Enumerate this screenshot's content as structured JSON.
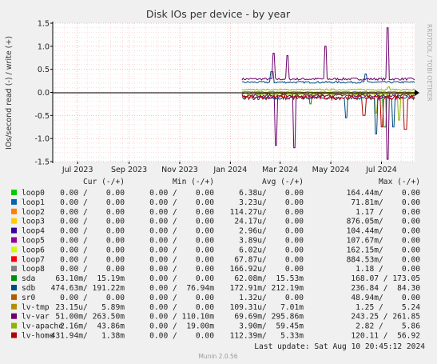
{
  "chart_data": {
    "type": "line",
    "title": "Disk IOs per device - by year",
    "ylabel": "IOs/second read (-) / write (+)",
    "ylim": [
      -1.5,
      1.5
    ],
    "yticks": [
      "1.5",
      "1.0",
      "0.5",
      "0.0",
      "-0.5",
      "-1.0",
      "-1.5"
    ],
    "ytick_values": [
      1.5,
      1.0,
      0.5,
      0.0,
      -0.5,
      -1.0,
      -1.5
    ],
    "xlim": [
      "2023-06-01",
      "2024-08-10"
    ],
    "xticks": [
      {
        "label": "Jul 2023",
        "date": "2023-07-01"
      },
      {
        "label": "Sep 2023",
        "date": "2023-09-01"
      },
      {
        "label": "Nov 2023",
        "date": "2023-11-01"
      },
      {
        "label": "Jan 2024",
        "date": "2024-01-01"
      },
      {
        "label": "Mar 2024",
        "date": "2024-03-01"
      },
      {
        "label": "May 2024",
        "date": "2024-05-01"
      },
      {
        "label": "Jul 2024",
        "date": "2024-07-01"
      }
    ],
    "grid": true,
    "side_text": "RRDTOOL / TOBI OETIKER",
    "legend_header": {
      "cur": "Cur (-/+)",
      "min": "Min (-/+)",
      "avg": "Avg (-/+)",
      "max": "Max (-/+)"
    },
    "series": [
      {
        "name": "loop0",
        "color": "#00cc00",
        "cur": "0.00 /    0.00",
        "min": "0.00 /    0.00",
        "avg": "6.38u/    0.00",
        "max": "164.44m/    0.00"
      },
      {
        "name": "loop1",
        "color": "#0066b3",
        "cur": "0.00 /    0.00",
        "min": "0.00 /    0.00",
        "avg": "3.23u/    0.00",
        "max": "71.81m/    0.00"
      },
      {
        "name": "loop2",
        "color": "#ff8000",
        "cur": "0.00 /    0.00",
        "min": "0.00 /    0.00",
        "avg": "114.27u/    0.00",
        "max": "1.17 /    0.00"
      },
      {
        "name": "loop3",
        "color": "#ffcc00",
        "cur": "0.00 /    0.00",
        "min": "0.00 /    0.00",
        "avg": "24.17u/    0.00",
        "max": "876.05m/    0.00"
      },
      {
        "name": "loop4",
        "color": "#330099",
        "cur": "0.00 /    0.00",
        "min": "0.00 /    0.00",
        "avg": "2.96u/    0.00",
        "max": "104.44m/    0.00"
      },
      {
        "name": "loop5",
        "color": "#990099",
        "cur": "0.00 /    0.00",
        "min": "0.00 /    0.00",
        "avg": "3.89u/    0.00",
        "max": "107.67m/    0.00"
      },
      {
        "name": "loop6",
        "color": "#ccff00",
        "cur": "0.00 /    0.00",
        "min": "0.00 /    0.00",
        "avg": "6.02u/    0.00",
        "max": "162.15m/    0.00"
      },
      {
        "name": "loop7",
        "color": "#ff0000",
        "cur": "0.00 /    0.00",
        "min": "0.00 /    0.00",
        "avg": "67.87u/    0.00",
        "max": "884.53m/    0.00"
      },
      {
        "name": "loop8",
        "color": "#808080",
        "cur": "0.00 /    0.00",
        "min": "0.00 /    0.00",
        "avg": "166.92u/    0.00",
        "max": "1.18 /    0.00"
      },
      {
        "name": "sda",
        "color": "#008f00",
        "cur": "63.10m/  15.19m",
        "min": "0.00 /    0.00",
        "avg": "62.08m/  15.53m",
        "max": "168.07 / 173.05"
      },
      {
        "name": "sdb",
        "color": "#00487d",
        "cur": "474.63m/ 191.22m",
        "min": "0.00 /  76.94m",
        "avg": "172.91m/ 212.19m",
        "max": "236.84 /  84.30"
      },
      {
        "name": "sr0",
        "color": "#b35a00",
        "cur": "0.00 /    0.00",
        "min": "0.00 /    0.00",
        "avg": "1.32u/    0.00",
        "max": "48.94m/    0.00"
      },
      {
        "name": "lv-tmp",
        "color": "#b38f00",
        "cur": "23.15u/   5.89m",
        "min": "0.00 /    0.00",
        "avg": "109.31u/   7.01m",
        "max": "1.25 /    5.24"
      },
      {
        "name": "lv-var",
        "color": "#6b006b",
        "cur": "51.00m/ 263.50m",
        "min": "0.00 / 110.10m",
        "avg": "69.69m/ 295.86m",
        "max": "243.25 / 261.85"
      },
      {
        "name": "lv-apache",
        "color": "#8fb300",
        "cur": "2.16m/  43.86m",
        "min": "0.00 /  19.00m",
        "avg": "3.90m/  59.45m",
        "max": "2.82 /    5.86"
      },
      {
        "name": "lv-home",
        "color": "#b30000",
        "cur": "431.94m/   1.38m",
        "min": "0.00 /    0.00",
        "avg": "112.39m/   5.33m",
        "max": "120.11 /  56.92"
      }
    ],
    "last_update": "Last update: Sat Aug 10 20:45:12 2024",
    "footer": "Munin 2.0.56"
  }
}
